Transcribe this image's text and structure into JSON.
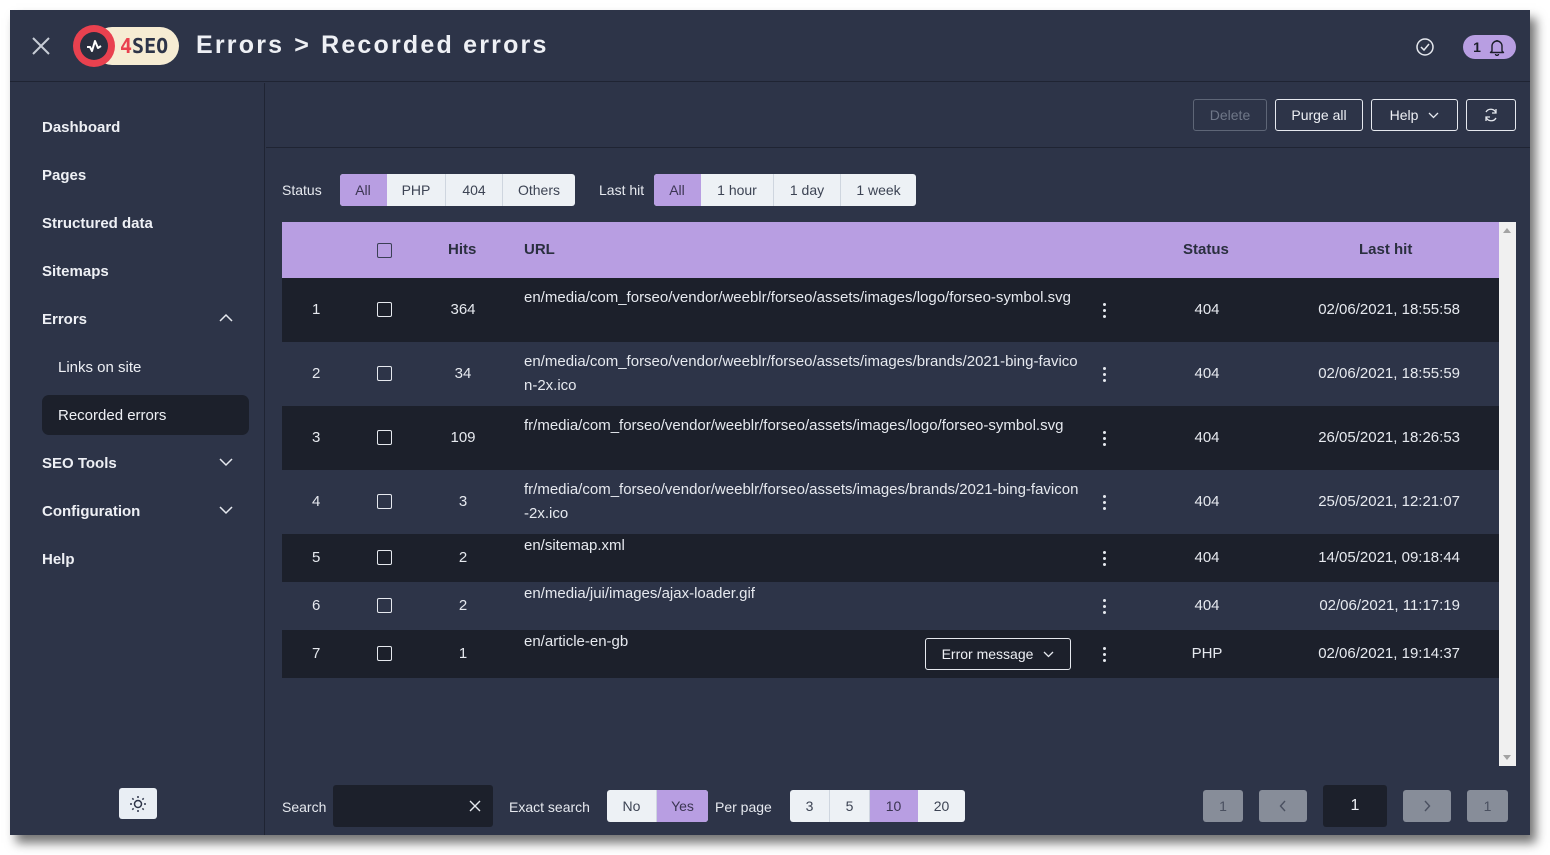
{
  "header": {
    "logo_text_accent": "4",
    "logo_text": "SEO",
    "breadcrumb_parent": "Errors",
    "breadcrumb_separator": ">",
    "breadcrumb_current": "Recorded errors",
    "notification_count": "1"
  },
  "sidebar": {
    "items": [
      {
        "label": "Dashboard"
      },
      {
        "label": "Pages"
      },
      {
        "label": "Structured data"
      },
      {
        "label": "Sitemaps"
      },
      {
        "label": "Errors",
        "expanded": true
      },
      {
        "label": "Links on site"
      },
      {
        "label": "Recorded errors",
        "active": true
      },
      {
        "label": "SEO Tools",
        "expanded": false
      },
      {
        "label": "Configuration",
        "expanded": false
      },
      {
        "label": "Help"
      }
    ]
  },
  "toolbar": {
    "delete_label": "Delete",
    "purge_label": "Purge all",
    "help_label": "Help"
  },
  "filters": {
    "status_label": "Status",
    "status_options": [
      "All",
      "PHP",
      "404",
      "Others"
    ],
    "status_selected": "All",
    "lasthit_label": "Last hit",
    "lasthit_options": [
      "All",
      "1 hour",
      "1 day",
      "1 week"
    ],
    "lasthit_selected": "All"
  },
  "table": {
    "columns": {
      "hits": "Hits",
      "url": "URL",
      "status": "Status",
      "last_hit": "Last hit"
    },
    "rows": [
      {
        "num": "1",
        "hits": "364",
        "url": "en/media/com_forseo/vendor/weeblr/forseo/assets/images/logo/forseo-symbol.svg",
        "status": "404",
        "last_hit": "02/06/2021, 18:55:58"
      },
      {
        "num": "2",
        "hits": "34",
        "url": "en/media/com_forseo/vendor/weeblr/forseo/assets/images/brands/2021-bing-favicon-2x.ico",
        "status": "404",
        "last_hit": "02/06/2021, 18:55:59"
      },
      {
        "num": "3",
        "hits": "109",
        "url": "fr/media/com_forseo/vendor/weeblr/forseo/assets/images/logo/forseo-symbol.svg",
        "status": "404",
        "last_hit": "26/05/2021, 18:26:53"
      },
      {
        "num": "4",
        "hits": "3",
        "url": "fr/media/com_forseo/vendor/weeblr/forseo/assets/images/brands/2021-bing-favicon-2x.ico",
        "status": "404",
        "last_hit": "25/05/2021, 12:21:07"
      },
      {
        "num": "5",
        "hits": "2",
        "url": "en/sitemap.xml",
        "status": "404",
        "last_hit": "14/05/2021, 09:18:44"
      },
      {
        "num": "6",
        "hits": "2",
        "url": "en/media/jui/images/ajax-loader.gif",
        "status": "404",
        "last_hit": "02/06/2021, 11:17:19"
      },
      {
        "num": "7",
        "hits": "1",
        "url": "en/article-en-gb",
        "status": "PHP",
        "last_hit": "02/06/2021, 19:14:37",
        "action_label": "Error message"
      }
    ]
  },
  "footer": {
    "search_label": "Search",
    "search_value": "",
    "exact_label": "Exact search",
    "exact_options": [
      "No",
      "Yes"
    ],
    "exact_selected": "Yes",
    "perpage_label": "Per page",
    "perpage_options": [
      "3",
      "5",
      "10",
      "20"
    ],
    "perpage_selected": "10",
    "pagination": {
      "first": "1",
      "current": "1",
      "last": "1"
    }
  },
  "colors": {
    "accent": "#b89ee2",
    "background": "#2d3448",
    "row_dark": "#1c202b",
    "logo_red": "#e9414f",
    "logo_cream": "#f6ecd3"
  }
}
